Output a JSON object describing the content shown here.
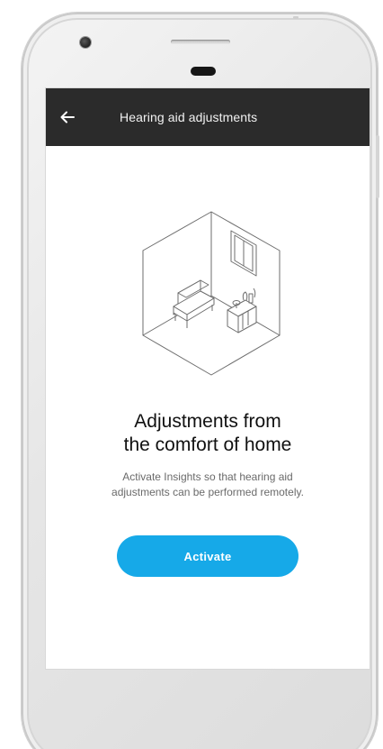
{
  "appbar": {
    "back_icon": "arrow-left-icon",
    "title": "Hearing aid adjustments"
  },
  "illustration": {
    "icon": "room-illustration-icon"
  },
  "content": {
    "headline_line1": "Adjustments from",
    "headline_line2": "the comfort of home",
    "description_line1": "Activate Insights so that hearing aid",
    "description_line2": "adjustments can be performed remotely."
  },
  "actions": {
    "activate_label": "Activate"
  },
  "colors": {
    "appbar_background": "#2b2b2b",
    "accent_button": "#16a9e8",
    "headline_text": "#111111",
    "description_text": "#6a6a6a"
  }
}
